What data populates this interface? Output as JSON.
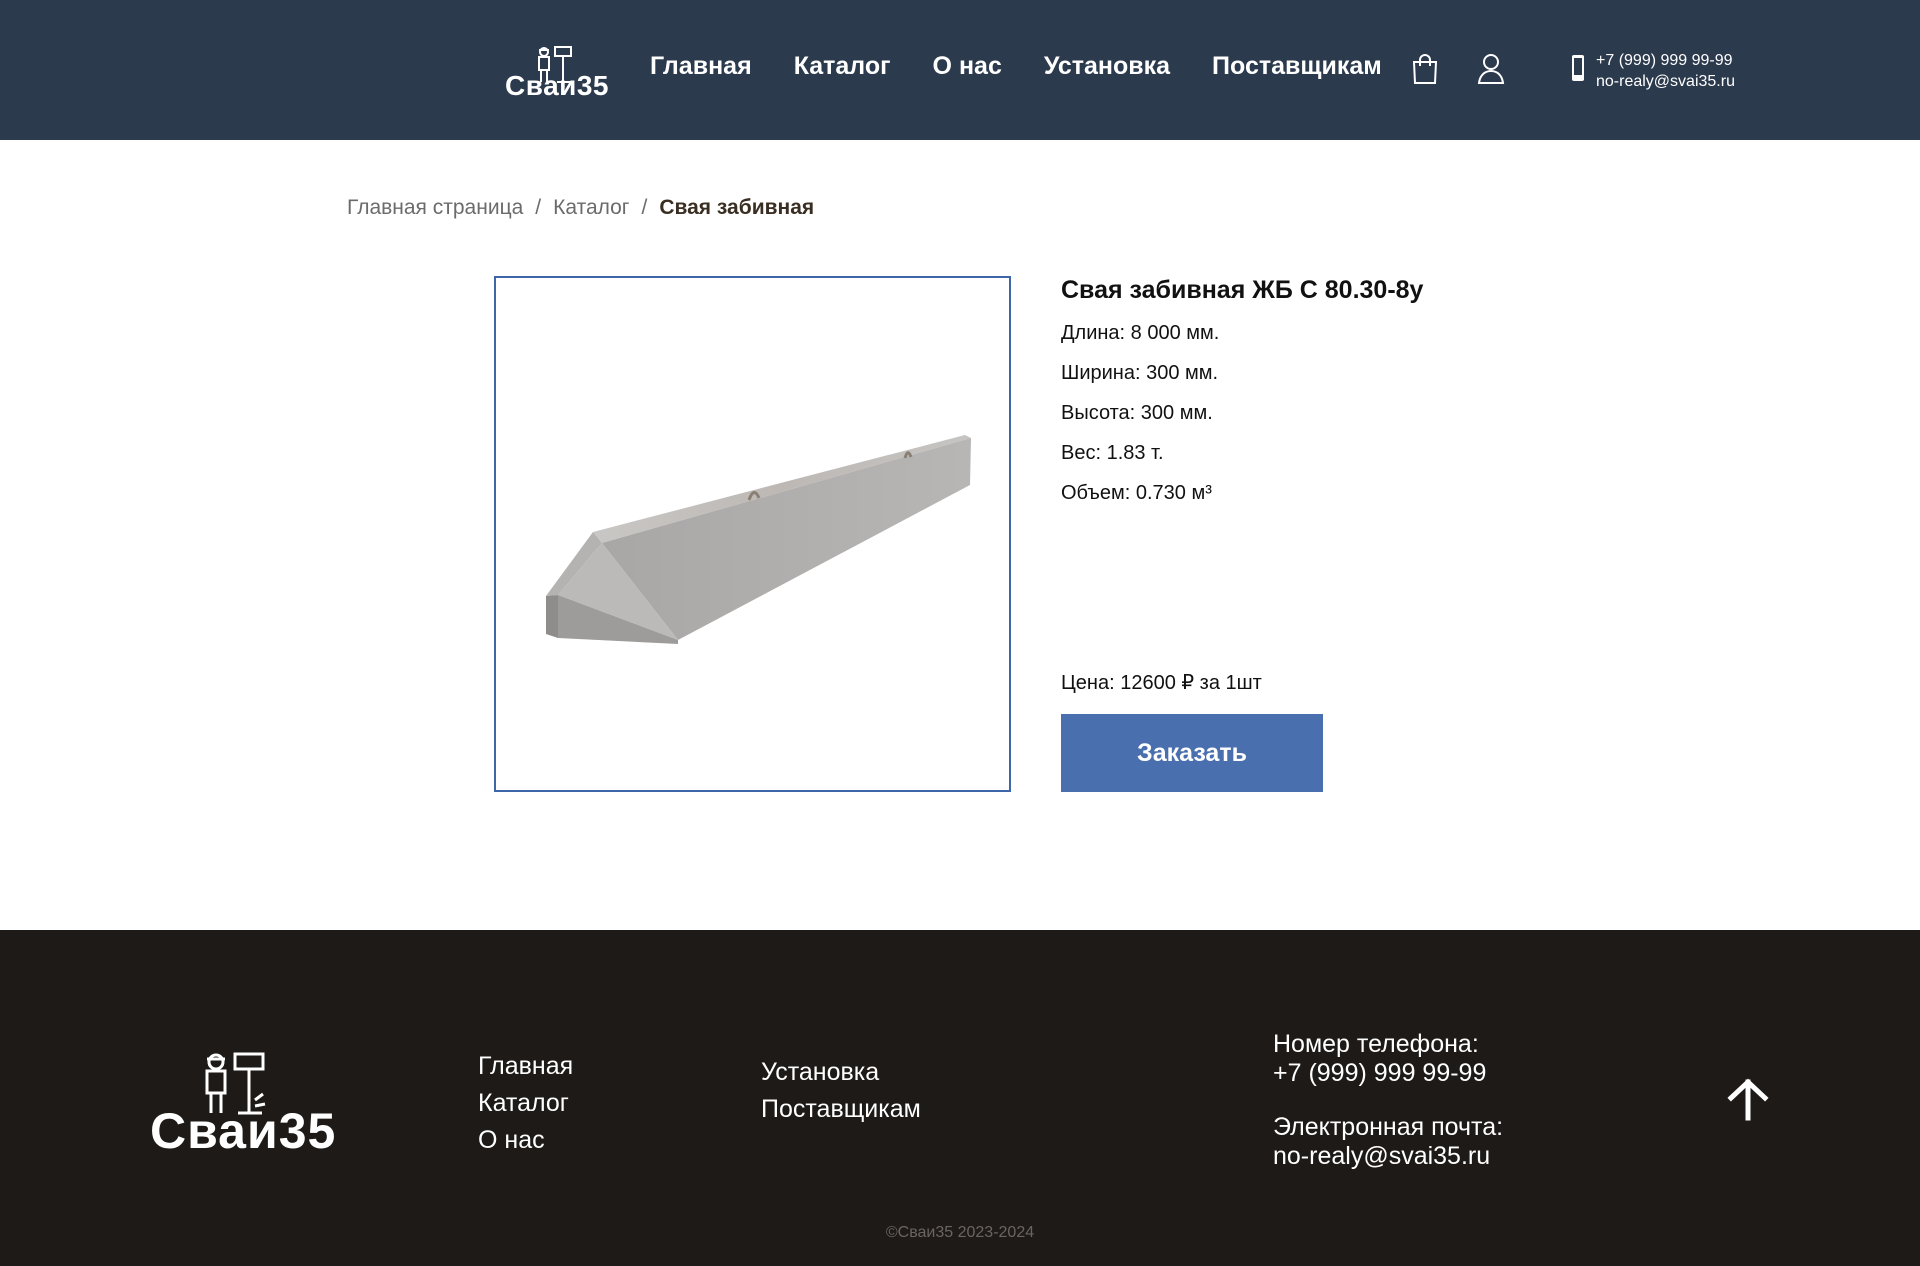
{
  "brand": {
    "name": "Сваи35"
  },
  "header": {
    "nav": [
      {
        "label": "Главная"
      },
      {
        "label": "Каталог"
      },
      {
        "label": "О нас"
      },
      {
        "label": "Установка"
      },
      {
        "label": "Поставщикам"
      }
    ],
    "icons": {
      "cart": "shopping-bag-icon",
      "account": "user-icon",
      "phone": "mobile-phone-icon"
    },
    "contact": {
      "phone": "+7 (999) 999 99-99",
      "email": "no-realy@svai35.ru"
    }
  },
  "breadcrumb": {
    "items": [
      "Главная страница",
      "Каталог"
    ],
    "separator": "/",
    "current": "Свая забивная"
  },
  "product": {
    "title": "Свая забивная ЖБ С 80.30-8у",
    "specs": [
      "Длина: 8 000 мм.",
      "Ширина: 300 мм.",
      "Высота: 300 мм.",
      "Вес: 1.83 т.",
      "Объем: 0.730 м³"
    ],
    "price": "Цена: 12600 ₽ за 1шт",
    "order_label": "Заказать"
  },
  "footer": {
    "col1": [
      "Главная",
      "Каталог",
      "О нас"
    ],
    "col2": [
      "Установка",
      "Поставщикам"
    ],
    "phone_label": "Номер телефона:",
    "phone": "+7 (999) 999 99-99",
    "email_label": "Электронная почта:",
    "email": "no-realy@svai35.ru",
    "copyright": "©Сваи35 2023-2024"
  },
  "colors": {
    "header_bg": "#2b3a4d",
    "footer_bg": "#1e1a17",
    "accent": "#4a6fae",
    "image_border": "#3e66a8"
  }
}
